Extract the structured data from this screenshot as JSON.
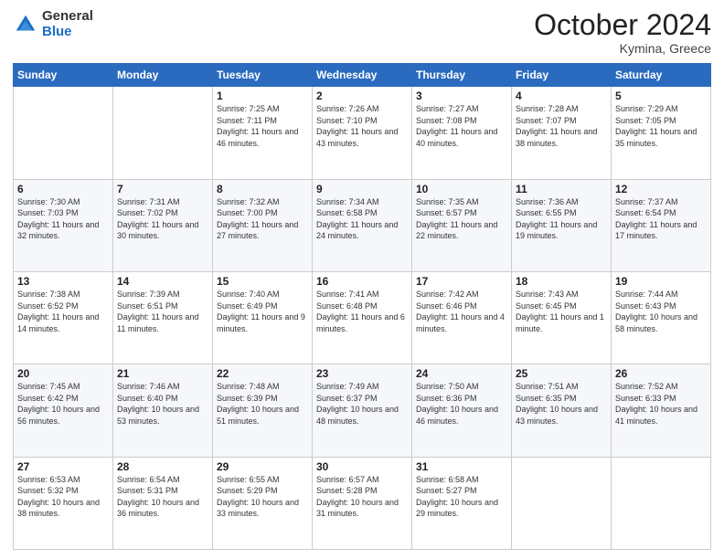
{
  "header": {
    "logo": {
      "general": "General",
      "blue": "Blue"
    },
    "title": "October 2024",
    "subtitle": "Kymina, Greece"
  },
  "days_of_week": [
    "Sunday",
    "Monday",
    "Tuesday",
    "Wednesday",
    "Thursday",
    "Friday",
    "Saturday"
  ],
  "weeks": [
    [
      {
        "day": "",
        "info": ""
      },
      {
        "day": "",
        "info": ""
      },
      {
        "day": "1",
        "info": "Sunrise: 7:25 AM\nSunset: 7:11 PM\nDaylight: 11 hours and 46 minutes."
      },
      {
        "day": "2",
        "info": "Sunrise: 7:26 AM\nSunset: 7:10 PM\nDaylight: 11 hours and 43 minutes."
      },
      {
        "day": "3",
        "info": "Sunrise: 7:27 AM\nSunset: 7:08 PM\nDaylight: 11 hours and 40 minutes."
      },
      {
        "day": "4",
        "info": "Sunrise: 7:28 AM\nSunset: 7:07 PM\nDaylight: 11 hours and 38 minutes."
      },
      {
        "day": "5",
        "info": "Sunrise: 7:29 AM\nSunset: 7:05 PM\nDaylight: 11 hours and 35 minutes."
      }
    ],
    [
      {
        "day": "6",
        "info": "Sunrise: 7:30 AM\nSunset: 7:03 PM\nDaylight: 11 hours and 32 minutes."
      },
      {
        "day": "7",
        "info": "Sunrise: 7:31 AM\nSunset: 7:02 PM\nDaylight: 11 hours and 30 minutes."
      },
      {
        "day": "8",
        "info": "Sunrise: 7:32 AM\nSunset: 7:00 PM\nDaylight: 11 hours and 27 minutes."
      },
      {
        "day": "9",
        "info": "Sunrise: 7:34 AM\nSunset: 6:58 PM\nDaylight: 11 hours and 24 minutes."
      },
      {
        "day": "10",
        "info": "Sunrise: 7:35 AM\nSunset: 6:57 PM\nDaylight: 11 hours and 22 minutes."
      },
      {
        "day": "11",
        "info": "Sunrise: 7:36 AM\nSunset: 6:55 PM\nDaylight: 11 hours and 19 minutes."
      },
      {
        "day": "12",
        "info": "Sunrise: 7:37 AM\nSunset: 6:54 PM\nDaylight: 11 hours and 17 minutes."
      }
    ],
    [
      {
        "day": "13",
        "info": "Sunrise: 7:38 AM\nSunset: 6:52 PM\nDaylight: 11 hours and 14 minutes."
      },
      {
        "day": "14",
        "info": "Sunrise: 7:39 AM\nSunset: 6:51 PM\nDaylight: 11 hours and 11 minutes."
      },
      {
        "day": "15",
        "info": "Sunrise: 7:40 AM\nSunset: 6:49 PM\nDaylight: 11 hours and 9 minutes."
      },
      {
        "day": "16",
        "info": "Sunrise: 7:41 AM\nSunset: 6:48 PM\nDaylight: 11 hours and 6 minutes."
      },
      {
        "day": "17",
        "info": "Sunrise: 7:42 AM\nSunset: 6:46 PM\nDaylight: 11 hours and 4 minutes."
      },
      {
        "day": "18",
        "info": "Sunrise: 7:43 AM\nSunset: 6:45 PM\nDaylight: 11 hours and 1 minute."
      },
      {
        "day": "19",
        "info": "Sunrise: 7:44 AM\nSunset: 6:43 PM\nDaylight: 10 hours and 58 minutes."
      }
    ],
    [
      {
        "day": "20",
        "info": "Sunrise: 7:45 AM\nSunset: 6:42 PM\nDaylight: 10 hours and 56 minutes."
      },
      {
        "day": "21",
        "info": "Sunrise: 7:46 AM\nSunset: 6:40 PM\nDaylight: 10 hours and 53 minutes."
      },
      {
        "day": "22",
        "info": "Sunrise: 7:48 AM\nSunset: 6:39 PM\nDaylight: 10 hours and 51 minutes."
      },
      {
        "day": "23",
        "info": "Sunrise: 7:49 AM\nSunset: 6:37 PM\nDaylight: 10 hours and 48 minutes."
      },
      {
        "day": "24",
        "info": "Sunrise: 7:50 AM\nSunset: 6:36 PM\nDaylight: 10 hours and 46 minutes."
      },
      {
        "day": "25",
        "info": "Sunrise: 7:51 AM\nSunset: 6:35 PM\nDaylight: 10 hours and 43 minutes."
      },
      {
        "day": "26",
        "info": "Sunrise: 7:52 AM\nSunset: 6:33 PM\nDaylight: 10 hours and 41 minutes."
      }
    ],
    [
      {
        "day": "27",
        "info": "Sunrise: 6:53 AM\nSunset: 5:32 PM\nDaylight: 10 hours and 38 minutes."
      },
      {
        "day": "28",
        "info": "Sunrise: 6:54 AM\nSunset: 5:31 PM\nDaylight: 10 hours and 36 minutes."
      },
      {
        "day": "29",
        "info": "Sunrise: 6:55 AM\nSunset: 5:29 PM\nDaylight: 10 hours and 33 minutes."
      },
      {
        "day": "30",
        "info": "Sunrise: 6:57 AM\nSunset: 5:28 PM\nDaylight: 10 hours and 31 minutes."
      },
      {
        "day": "31",
        "info": "Sunrise: 6:58 AM\nSunset: 5:27 PM\nDaylight: 10 hours and 29 minutes."
      },
      {
        "day": "",
        "info": ""
      },
      {
        "day": "",
        "info": ""
      }
    ]
  ]
}
